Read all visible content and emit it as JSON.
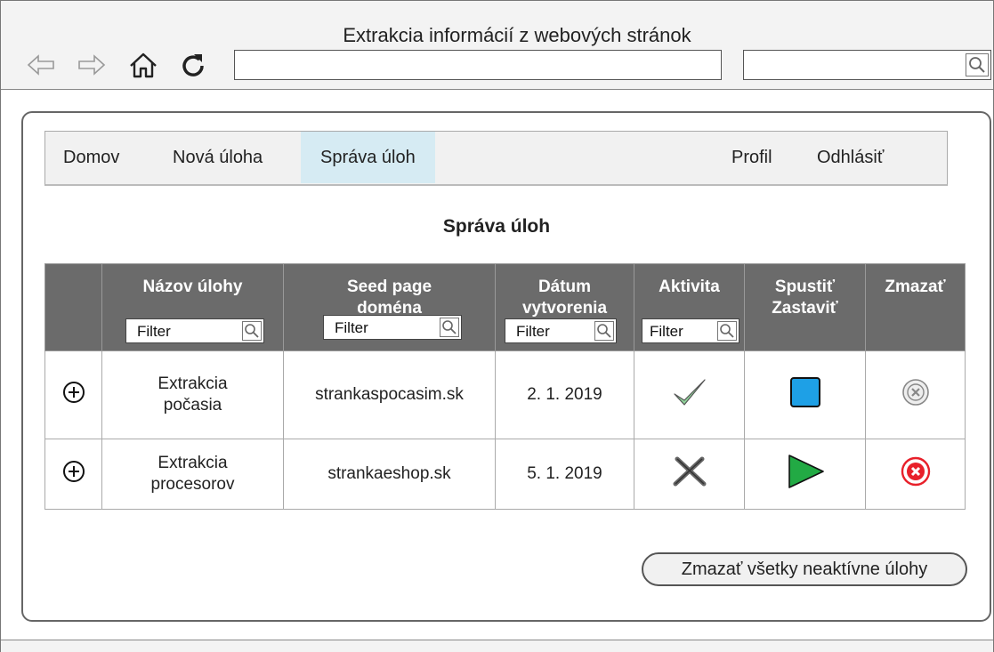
{
  "window": {
    "title": "Extrakcia informácií z webových stránok"
  },
  "browser": {
    "url": "",
    "search": ""
  },
  "menu": {
    "items": [
      {
        "label": "Domov"
      },
      {
        "label": "Nová úloha"
      },
      {
        "label": "Správa úloh",
        "active": true
      },
      {
        "label": "Profil"
      },
      {
        "label": "Odhlásiť"
      }
    ]
  },
  "page": {
    "title": "Správa úloh"
  },
  "table": {
    "columns": [
      {
        "label": ""
      },
      {
        "label": "Názov úlohy",
        "filter": "Filter"
      },
      {
        "label": "Seed page doména",
        "filter": "Filter"
      },
      {
        "label": "Dátum vytvorenia",
        "filter": "Filter"
      },
      {
        "label": "Aktivita",
        "filter": "Filter"
      },
      {
        "label": "Spustiť Zastaviť"
      },
      {
        "label": "Zmazať"
      }
    ],
    "rows": [
      {
        "name": "Extrakcia počasia",
        "domain": "strankaspocasim.sk",
        "date": "2. 1. 2019",
        "active": true,
        "action_icon": "stop-icon",
        "delete_enabled": false
      },
      {
        "name": "Extrakcia procesorov",
        "domain": "strankaeshop.sk",
        "date": "5. 1. 2019",
        "active": false,
        "action_icon": "play-icon",
        "delete_enabled": true
      }
    ]
  },
  "actions": {
    "delete_inactive_label": "Zmazať všetky neaktívne úlohy"
  },
  "colors": {
    "menu_active": "#d6ebf3",
    "header_bg": "#6b6b6b",
    "stop": "#1ea0e6",
    "play": "#22aa44",
    "delete": "#e8202a"
  }
}
